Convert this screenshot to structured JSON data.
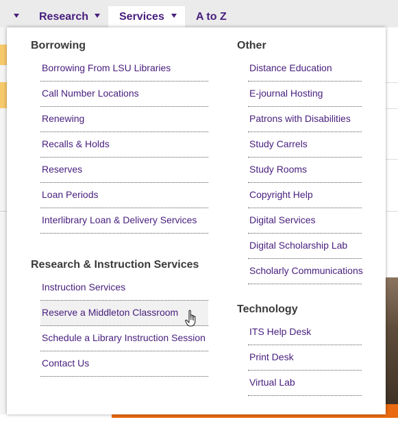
{
  "nav": {
    "research": "Research",
    "services": "Services",
    "atoz": "A to Z"
  },
  "menu": {
    "borrowing": {
      "heading": "Borrowing",
      "items": [
        "Borrowing From LSU Libraries",
        "Call Number Locations",
        "Renewing",
        "Recalls & Holds",
        "Reserves",
        "Loan Periods",
        "Interlibrary Loan & Delivery Services"
      ]
    },
    "research_instruction": {
      "heading": "Research & Instruction Services",
      "items": [
        "Instruction Services",
        "Reserve a Middleton Classroom",
        "Schedule a Library Instruction Session",
        "Contact Us"
      ],
      "hovered_index": 1
    },
    "other": {
      "heading": "Other",
      "items": [
        "Distance Education",
        "E-journal Hosting",
        "Patrons with Disabilities",
        "Study Carrels",
        "Study Rooms",
        "Copyright Help",
        "Digital Services",
        "Digital Scholarship Lab",
        "Scholarly Communications"
      ]
    },
    "technology": {
      "heading": "Technology",
      "items": [
        "ITS Help Desk",
        "Print Desk",
        "Virtual Lab"
      ]
    }
  },
  "colors": {
    "brand_purple": "#461d7c",
    "accent_orange": "#e96a10",
    "accent_gold": "#f6c96b",
    "hover_bg": "#f1f1f1"
  },
  "icons": {
    "caret": "chevron-down-icon",
    "cursor": "hand-pointer-icon"
  }
}
